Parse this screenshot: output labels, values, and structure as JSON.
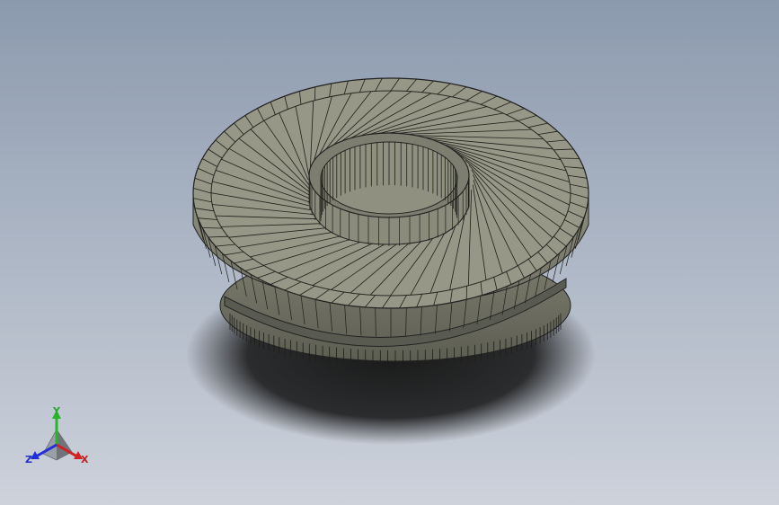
{
  "viewport": {
    "background_top": "#8c9aae",
    "background_bottom": "#cdd2db"
  },
  "model": {
    "body_color": "#8d8e7e",
    "top_face_color": "#9a9b8a",
    "shadow_color": "#1c1c1c",
    "mesh_line_color": "#1e1f1a"
  },
  "triad": {
    "x_label": "X",
    "y_label": "Y",
    "z_label": "Z",
    "x_color": "#d42020",
    "y_color": "#29b52a",
    "z_color": "#2030d8"
  }
}
